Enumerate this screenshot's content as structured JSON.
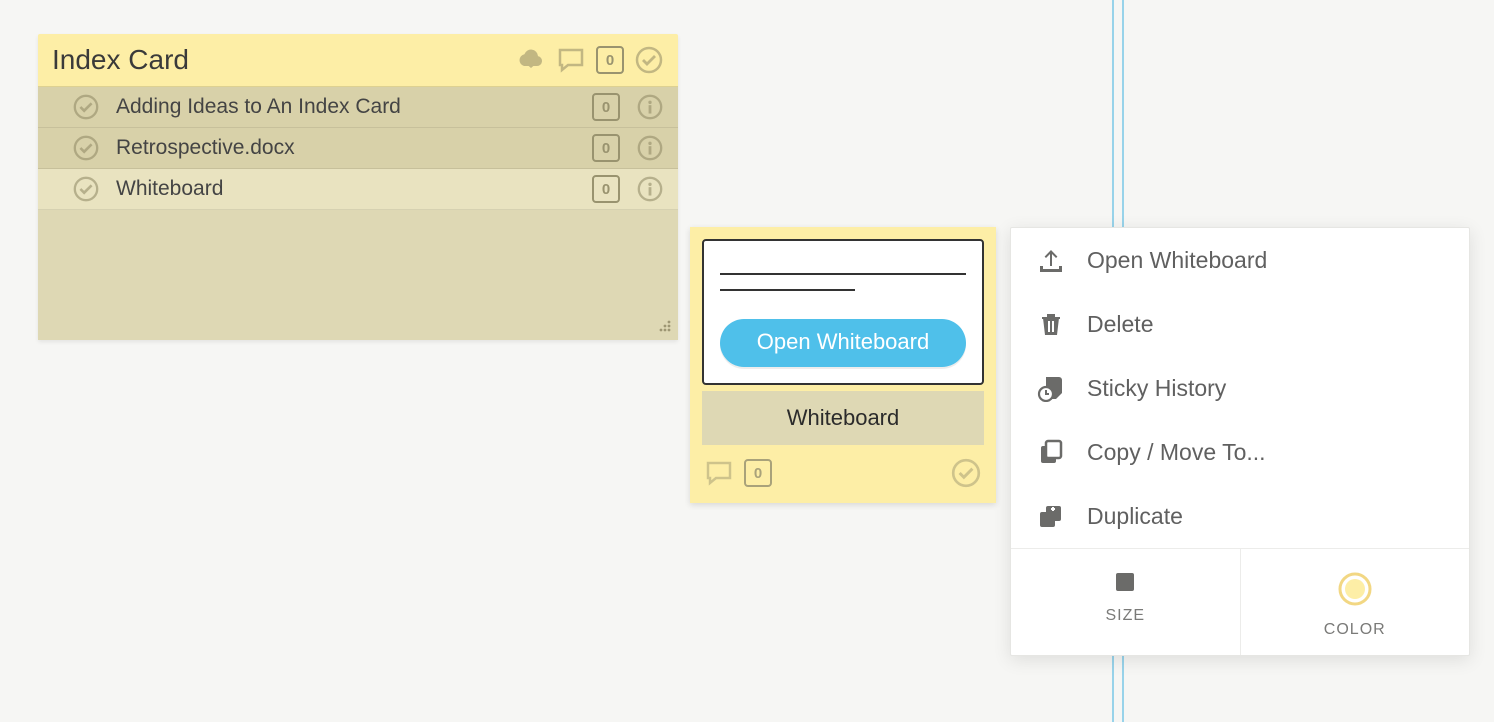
{
  "index_card": {
    "title": "Index Card",
    "header_count": "0",
    "rows": [
      {
        "label": "Adding Ideas to An Index Card",
        "count": "0"
      },
      {
        "label": "Retrospective.docx",
        "count": "0"
      },
      {
        "label": "Whiteboard",
        "count": "0"
      }
    ]
  },
  "sticky": {
    "open_button": "Open Whiteboard",
    "caption": "Whiteboard",
    "count": "0"
  },
  "context_menu": {
    "items": [
      {
        "label": "Open Whiteboard"
      },
      {
        "label": "Delete"
      },
      {
        "label": "Sticky History"
      },
      {
        "label": "Copy / Move To..."
      },
      {
        "label": "Duplicate"
      }
    ],
    "size_label": "SIZE",
    "color_label": "COLOR"
  }
}
